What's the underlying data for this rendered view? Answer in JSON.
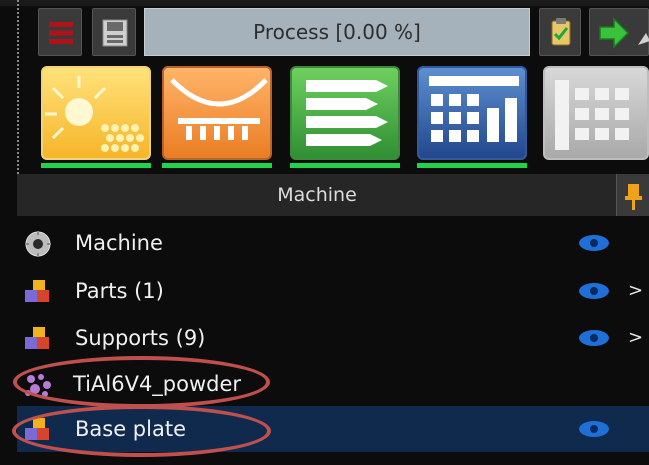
{
  "toolbar": {
    "process_label": "Process [0.00 %]"
  },
  "ribbon": {
    "buttons": [
      {
        "name": "build-preparation",
        "active": true
      },
      {
        "name": "machine",
        "active": true
      },
      {
        "name": "process-list",
        "active": true
      },
      {
        "name": "slice-view",
        "active": true
      },
      {
        "name": "greyed-tool",
        "active": false
      }
    ]
  },
  "panel": {
    "title": "Machine"
  },
  "tree": {
    "items": [
      {
        "label": "Machine",
        "icon": "gear-icon",
        "visible": true,
        "expandable": false,
        "selected": false
      },
      {
        "label": "Parts (1)",
        "icon": "parts-icon",
        "visible": true,
        "expandable": true,
        "chevron": ">",
        "selected": false
      },
      {
        "label": "Supports (9)",
        "icon": "parts-icon",
        "visible": true,
        "expandable": true,
        "chevron": ">",
        "selected": false
      },
      {
        "label": "TiAl6V4_powder",
        "icon": "powder-icon",
        "visible": false,
        "expandable": false,
        "selected": false
      },
      {
        "label": "Base plate",
        "icon": "parts-icon",
        "visible": true,
        "expandable": false,
        "selected": true
      }
    ]
  },
  "colors": {
    "background": "#0c0c0c",
    "selection": "#0f2a4d",
    "highlight_ellipse": "#c0504d",
    "eye": "#1e6fd6",
    "ribbon_active_underline": "#1fd34a"
  }
}
